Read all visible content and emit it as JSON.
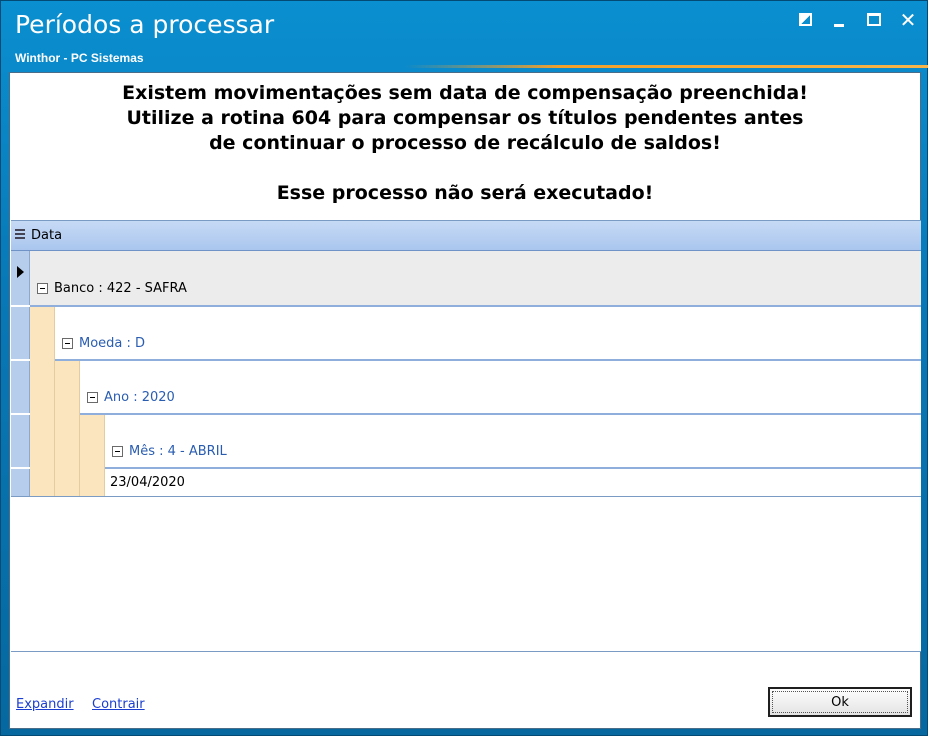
{
  "window": {
    "title": "Períodos a processar",
    "subtitle": "Winthor - PC Sistemas"
  },
  "message": {
    "line1": "Existem movimentações sem data de compensação preenchida!",
    "line2": "Utilize a rotina 604 para compensar os títulos pendentes antes",
    "line3": "de continuar o processo de recálculo de saldos!",
    "line4": "Esse processo não será executado!"
  },
  "grid": {
    "column_header": "Data",
    "groups": {
      "banco": "Banco : 422 - SAFRA",
      "moeda": "Moeda : D",
      "ano": "Ano : 2020",
      "mes": "Mês : 4 - ABRIL"
    },
    "data_row": "23/04/2020"
  },
  "footer": {
    "expand_label": "Expandir",
    "collapse_label": "Contrair",
    "ok_label": "Ok"
  }
}
